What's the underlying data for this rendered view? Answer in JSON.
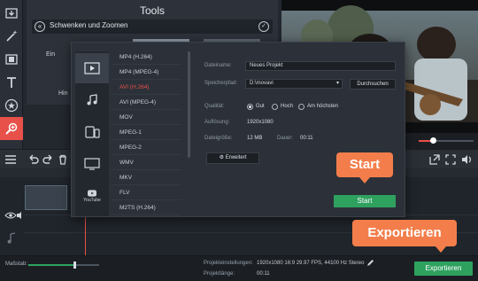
{
  "tools": {
    "title": "Tools",
    "subtitle": "Schwenken und Zoomen",
    "peek_left": "Ein",
    "peek_left2": "Hin"
  },
  "sidebar": {
    "items": [
      "import-icon",
      "magic-wand-icon",
      "film-icon",
      "text-icon",
      "star-icon",
      "pan-zoom-icon",
      "list-icon"
    ]
  },
  "dialog": {
    "formats": [
      "MP4 (H.264)",
      "MP4 (MPEG-4)",
      "AVI (H.264)",
      "AVI (MPEG-4)",
      "MOV",
      "MPEG-1",
      "MPEG-2",
      "WMV",
      "MKV",
      "FLV",
      "M2TS (H.264)"
    ],
    "selected_format": "AVI (H.264)",
    "categories": [
      "video-icon",
      "audio-icon",
      "devices-icon",
      "tv-icon",
      "youtube-icon"
    ],
    "youtube_label": "YouTube",
    "name_label": "Dateiname:",
    "name_value": "Neues Projekt",
    "path_label": "Speicherpfad:",
    "path_value": "D:\\movavi",
    "browse": "Durchsuchen",
    "quality_label": "Qualität:",
    "quality_options": [
      "Gut",
      "Hoch",
      "Am höchsten"
    ],
    "quality_selected": "Gut",
    "resolution_label": "Auflösung:",
    "resolution_value": "1920x1080",
    "size_label": "Dateigröße:",
    "size_value": "12 MB",
    "duration_label": "Dauer:",
    "duration_value": "00:11",
    "advanced": "Erweitert",
    "start": "Start"
  },
  "callouts": {
    "start": "Start",
    "export": "Exportieren"
  },
  "status": {
    "scale_label": "Maßstab:",
    "scale_level": 0.65,
    "settings_label": "Projekteinstellungen:",
    "settings_value": "1920x1080 16:9 29.97 FPS, 44100 Hz Stereo",
    "length_label": "Projektlänge:",
    "length_value": "00:11",
    "export": "Exportieren"
  },
  "player": {
    "seek_progress": 0.25
  },
  "colors": {
    "accent": "#e8504a",
    "green": "#2fa15f",
    "callout": "#f37e4b"
  }
}
